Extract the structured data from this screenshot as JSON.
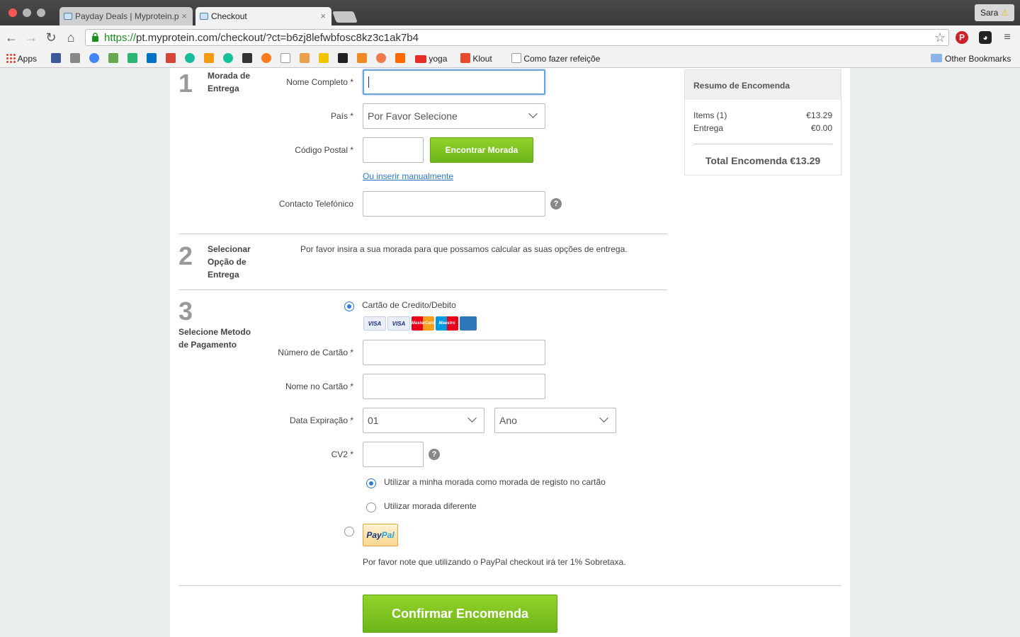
{
  "browser": {
    "tabs": [
      {
        "title": "Payday Deals | Myprotein.p",
        "active": false
      },
      {
        "title": "Checkout",
        "active": true
      }
    ],
    "profile_name": "Sara",
    "url_https": "https://",
    "url_rest": "pt.myprotein.com/checkout/?ct=b6zj8lefwbfosc8kz3c1ak7b4",
    "bookmarks": {
      "apps": "Apps",
      "yoga": "yoga",
      "klout": "Klout",
      "como": "Como fazer refeiçõe",
      "other": "Other Bookmarks"
    }
  },
  "checkout": {
    "step1": {
      "number": "1",
      "title_line1": "Morada de",
      "title_line2": "Entrega",
      "nome_label": "Nome Completo *",
      "pais_label": "País *",
      "pais_value": "Por Favor Selecione",
      "postal_label": "Código Postal *",
      "find_button": "Encontrar Morada",
      "manual_link": "Ou inserir manualmente",
      "phone_label": "Contacto Telefónico"
    },
    "step2": {
      "number": "2",
      "title_line1": "Selecionar",
      "title_line2": "Opção de",
      "title_line3": "Entrega",
      "message": "Por favor insira a sua morada para que possamos calcular as suas opções de entrega."
    },
    "step3": {
      "number": "3",
      "title_line1": "Selecione Metodo",
      "title_line2": "de Pagamento",
      "card_option": "Cartão de Credito/Debito",
      "cards": [
        "VISA",
        "VISA",
        "MasterCard",
        "Maestro",
        "AMEX"
      ],
      "card_number_label": "Número de Cartão *",
      "card_name_label": "Nome no Cartão *",
      "expiry_label": "Data Expiração *",
      "expiry_month": "01",
      "expiry_year": "Ano",
      "cv2_label": "CV2 *",
      "use_my_address": "Utilizar a minha morada como morada de registo no cartão",
      "use_other_address": "Utilizar morada diferente",
      "paypal_pay": "Pay",
      "paypal_pal": "Pal",
      "paypal_note": "Por favor note que utilizando o PayPal checkout irá ter 1% Sobretaxa."
    },
    "confirm_button": "Confirmar Encomenda"
  },
  "summary": {
    "title": "Resumo de Encomenda",
    "items_label": "Items (1)",
    "items_value": "€13.29",
    "delivery_label": "Entrega",
    "delivery_value": "€0.00",
    "total": "Total Encomenda €13.29"
  },
  "colors": {
    "accent_green": "#7ec421",
    "link_blue": "#2a78c8",
    "radio_blue": "#2b7bd6"
  }
}
